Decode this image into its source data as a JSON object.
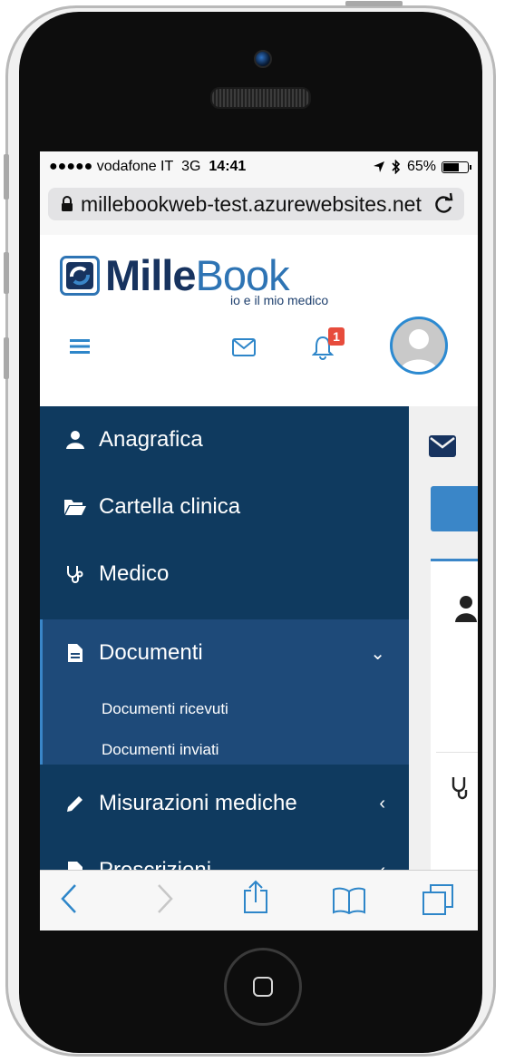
{
  "status_bar": {
    "carrier": "●●●●● vodafone IT",
    "network": "3G",
    "time": "14:41",
    "battery": "65%",
    "battery_level": 0.65
  },
  "browser": {
    "url": "millebookweb-test.azurewebsites.net"
  },
  "brand": {
    "name_bold": "Mille",
    "name_light": "Book",
    "tagline": "io e il mio medico"
  },
  "header": {
    "notification_count": "1"
  },
  "sidebar": {
    "items": [
      {
        "label": "Anagrafica",
        "icon": "user-icon"
      },
      {
        "label": "Cartella clinica",
        "icon": "folder-open-icon"
      },
      {
        "label": "Medico",
        "icon": "stethoscope-icon"
      },
      {
        "label": "Documenti",
        "icon": "file-icon",
        "arrow": "⌄"
      },
      {
        "label": "Misurazioni mediche",
        "icon": "pencil-icon",
        "arrow": "‹"
      },
      {
        "label": "Prescrizioni",
        "icon": "file-icon",
        "arrow": "‹"
      }
    ],
    "submenu": [
      {
        "label": "Documenti ricevuti"
      },
      {
        "label": "Documenti inviati"
      }
    ]
  },
  "colors": {
    "sidebar": "#0f3a5f",
    "sidebar_active": "#1e4a79",
    "accent": "#3a86c8",
    "badge": "#e74c3c"
  }
}
